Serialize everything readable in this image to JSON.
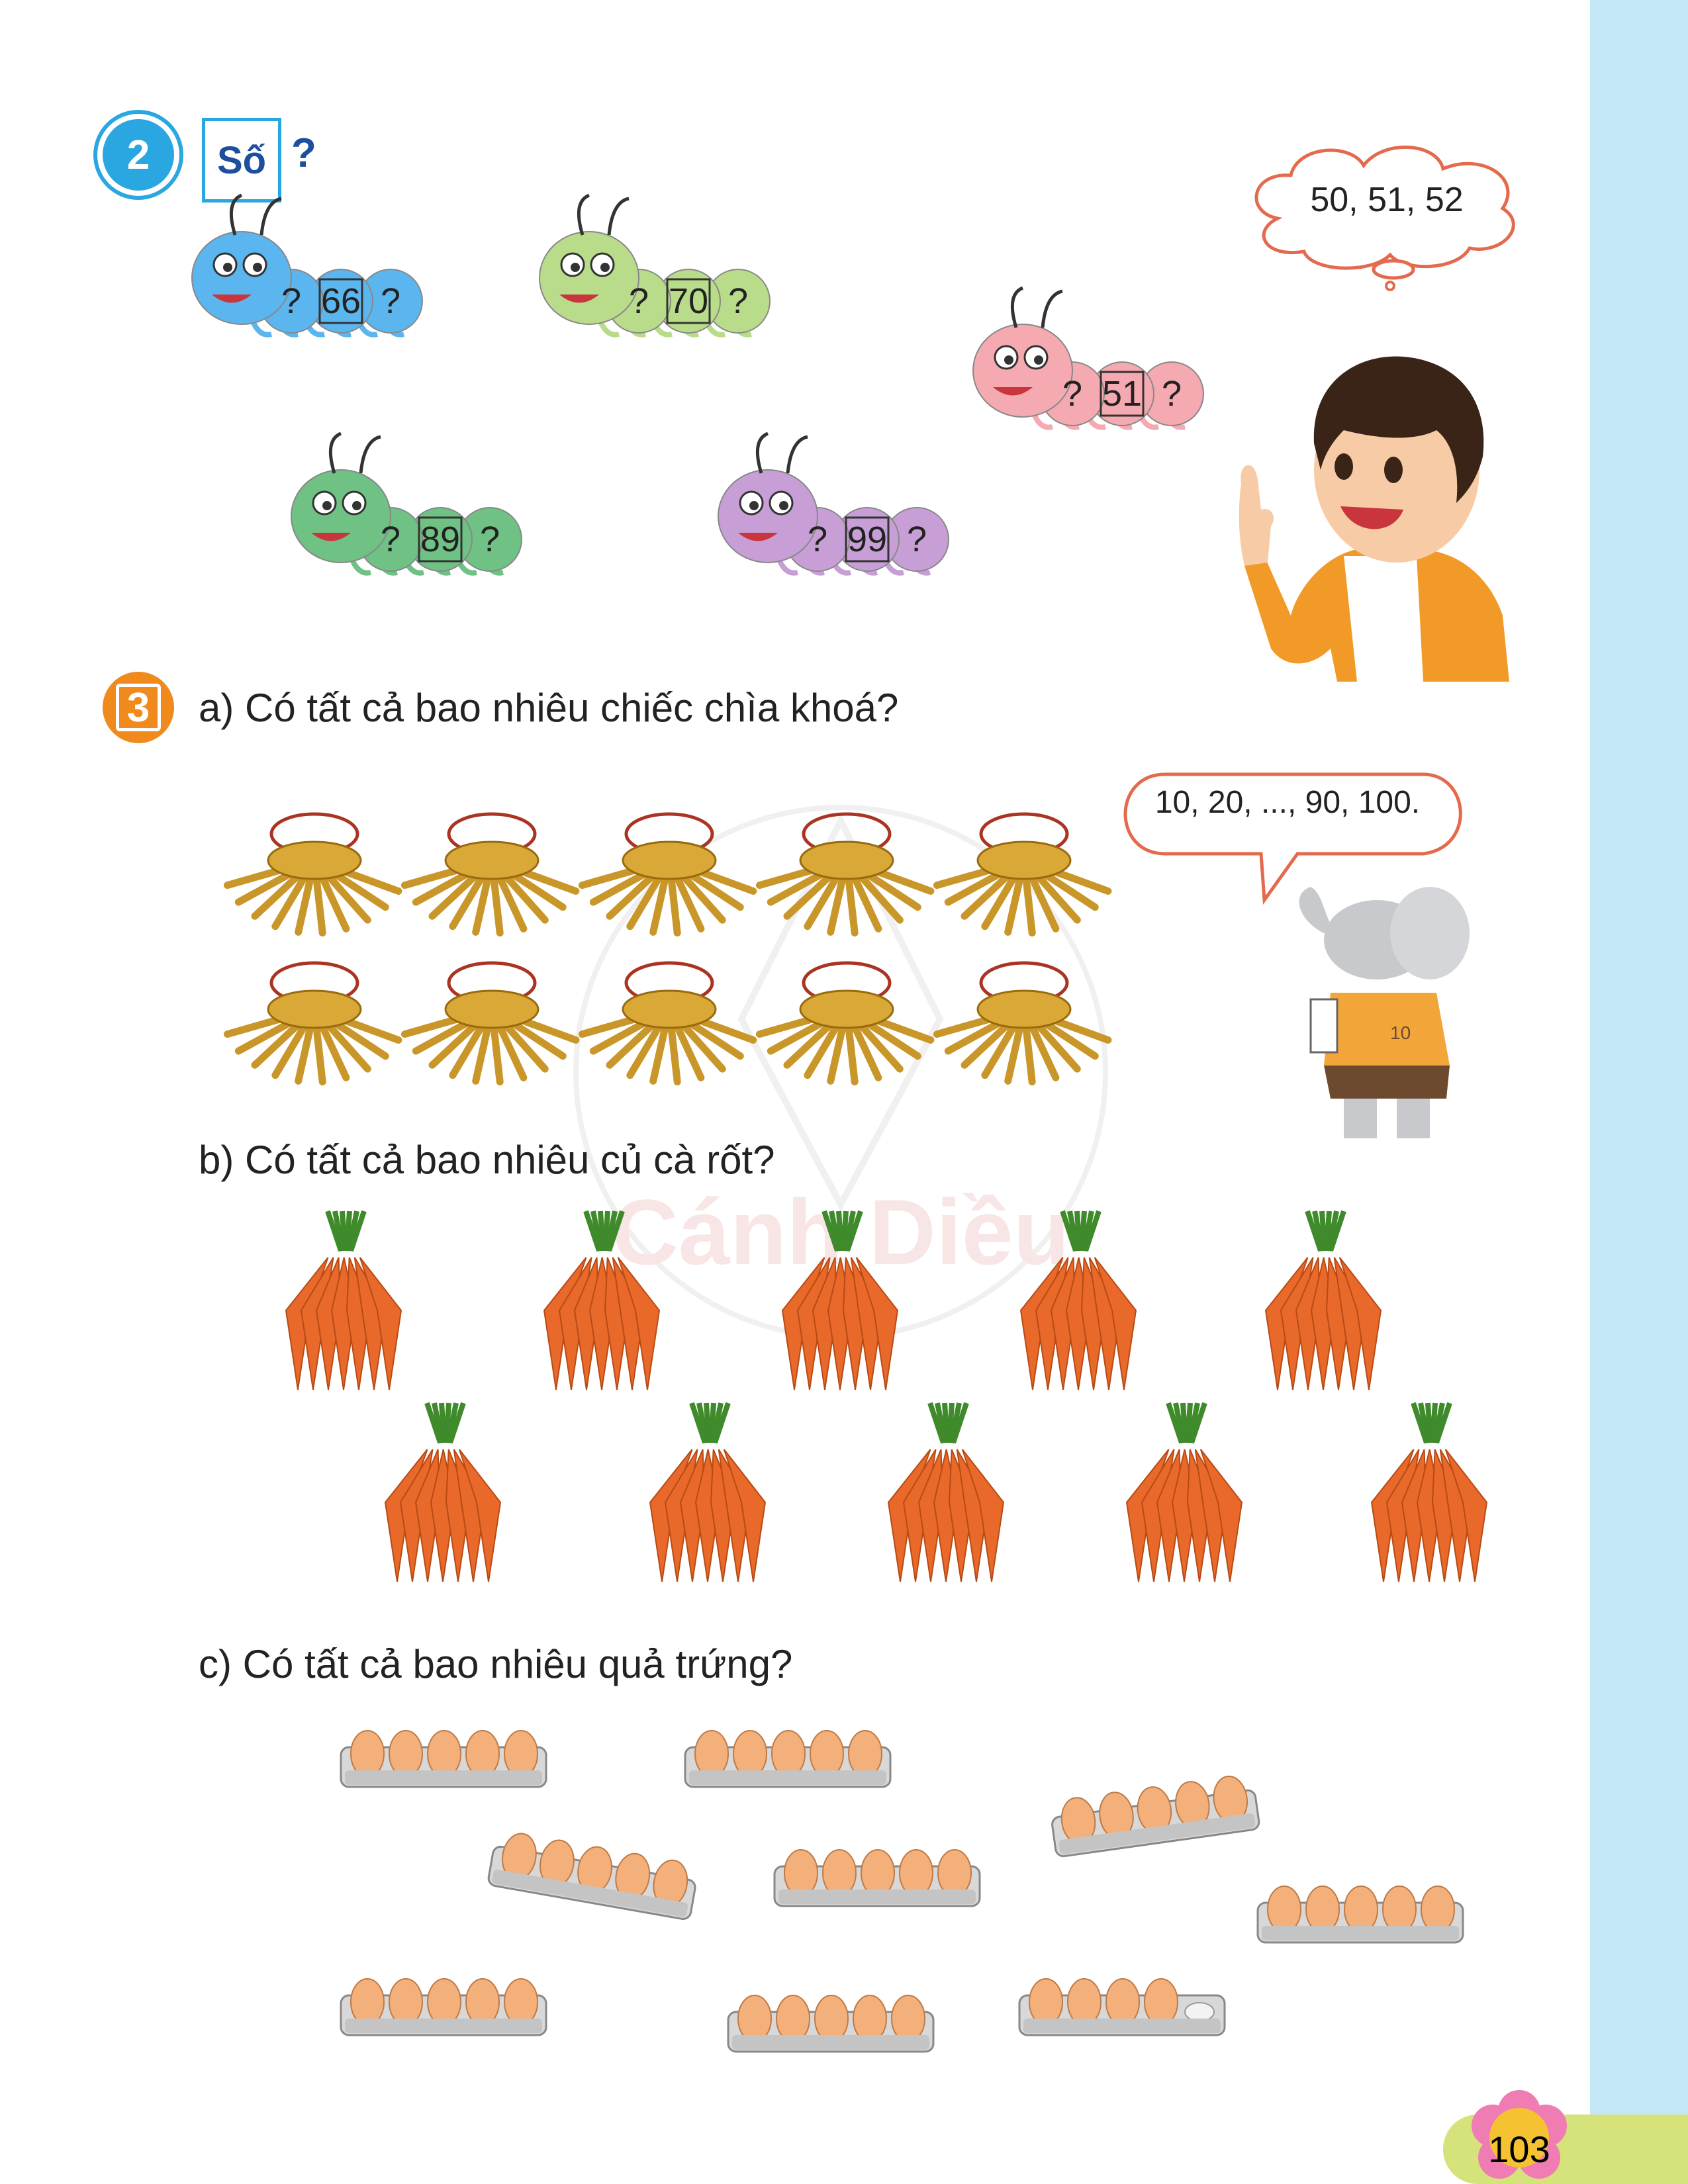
{
  "exercise2": {
    "number": "2",
    "prompt_box": "Số",
    "prompt_mark": "?",
    "caterpillars": [
      {
        "left": "?",
        "middle": "66",
        "right": "?",
        "color": "#5bb5ef"
      },
      {
        "left": "?",
        "middle": "70",
        "right": "?",
        "color": "#b9dc8a"
      },
      {
        "left": "?",
        "middle": "51",
        "right": "?",
        "color": "#f5a9b0"
      },
      {
        "left": "?",
        "middle": "89",
        "right": "?",
        "color": "#6fc184"
      },
      {
        "left": "?",
        "middle": "99",
        "right": "?",
        "color": "#c79fd6"
      }
    ],
    "thought": "50, 51, 52"
  },
  "exercise3": {
    "number": "3",
    "a": "a) Có tất cả bao nhiêu chiếc chìa khoá?",
    "b": "b) Có tất cả bao nhiêu củ cà rốt?",
    "c": "c) Có tất cả bao nhiêu quả trứng?",
    "speech": "10, 20, ..., 90, 100.",
    "elephant_shirt": "10"
  },
  "watermark": "Cánh Diều",
  "page_number": "103",
  "colors": {
    "blue": "#2aa7e0",
    "orange": "#f08a1c",
    "side_band": "#c5e8f8",
    "tab": "#d6e27a"
  }
}
